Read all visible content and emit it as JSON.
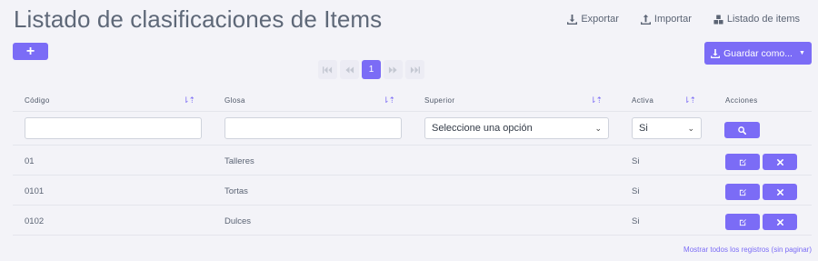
{
  "page": {
    "title": "Listado de clasificaciones de Items"
  },
  "top_links": [
    {
      "icon": "download-icon",
      "label": "Exportar"
    },
    {
      "icon": "upload-icon",
      "label": "Importar"
    },
    {
      "icon": "cubes-icon",
      "label": "Listado de items"
    }
  ],
  "add_button": {
    "label": "+"
  },
  "save_button": {
    "label": "Guardar como..."
  },
  "pagination": {
    "current": "1"
  },
  "table": {
    "headers": {
      "codigo": "Código",
      "glosa": "Glosa",
      "superior": "Superior",
      "activa": "Activa",
      "acciones": "Acciones"
    },
    "sort_glyph": "⇂⇡",
    "filters": {
      "codigo": "",
      "glosa": "",
      "superior": "Seleccione una opción",
      "activa": "Si"
    },
    "rows": [
      {
        "codigo": "01",
        "glosa": "Talleres",
        "superior": "",
        "activa": "Si"
      },
      {
        "codigo": "0101",
        "glosa": "Tortas",
        "superior": "",
        "activa": "Si"
      },
      {
        "codigo": "0102",
        "glosa": "Dulces",
        "superior": "",
        "activa": "Si"
      }
    ]
  },
  "footer": {
    "show_all": "Mostrar todos los registros (sin paginar)"
  },
  "colors": {
    "accent": "#7b6cf6",
    "background": "#f3f3f8",
    "text": "#5b6474"
  }
}
